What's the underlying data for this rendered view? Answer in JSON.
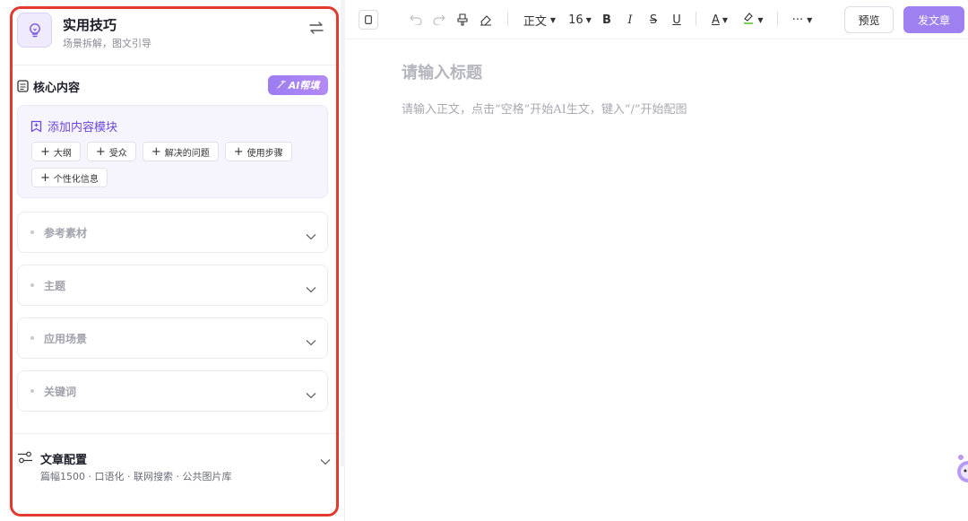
{
  "panel": {
    "title": "实用技巧",
    "subtitle": "场景拆解，图文引导",
    "core_label": "核心内容",
    "ai_fill": "AI帮填",
    "module_title": "添加内容模块",
    "chips": [
      "大纲",
      "受众",
      "解决的问题",
      "使用步骤",
      "个性化信息"
    ],
    "sections": [
      "参考素材",
      "主题",
      "应用场景",
      "关键词"
    ],
    "config_title": "文章配置",
    "config_desc": "篇幅1500 · 口语化 · 联网搜索 · 公共图片库"
  },
  "toolbar": {
    "style": "正文",
    "font_size": "16",
    "bold": "B",
    "italic": "I",
    "strike": "S",
    "underline": "U",
    "font_color": "A",
    "more": "···",
    "preview": "预览",
    "publish": "发文章"
  },
  "editor": {
    "title_placeholder": "请输入标题",
    "body_placeholder": "请输入正文，点击“空格”开始AI生文，键入“/”开始配图"
  },
  "colors": {
    "accent": "#9e80f0",
    "highlight_frame": "#e23a2e"
  }
}
